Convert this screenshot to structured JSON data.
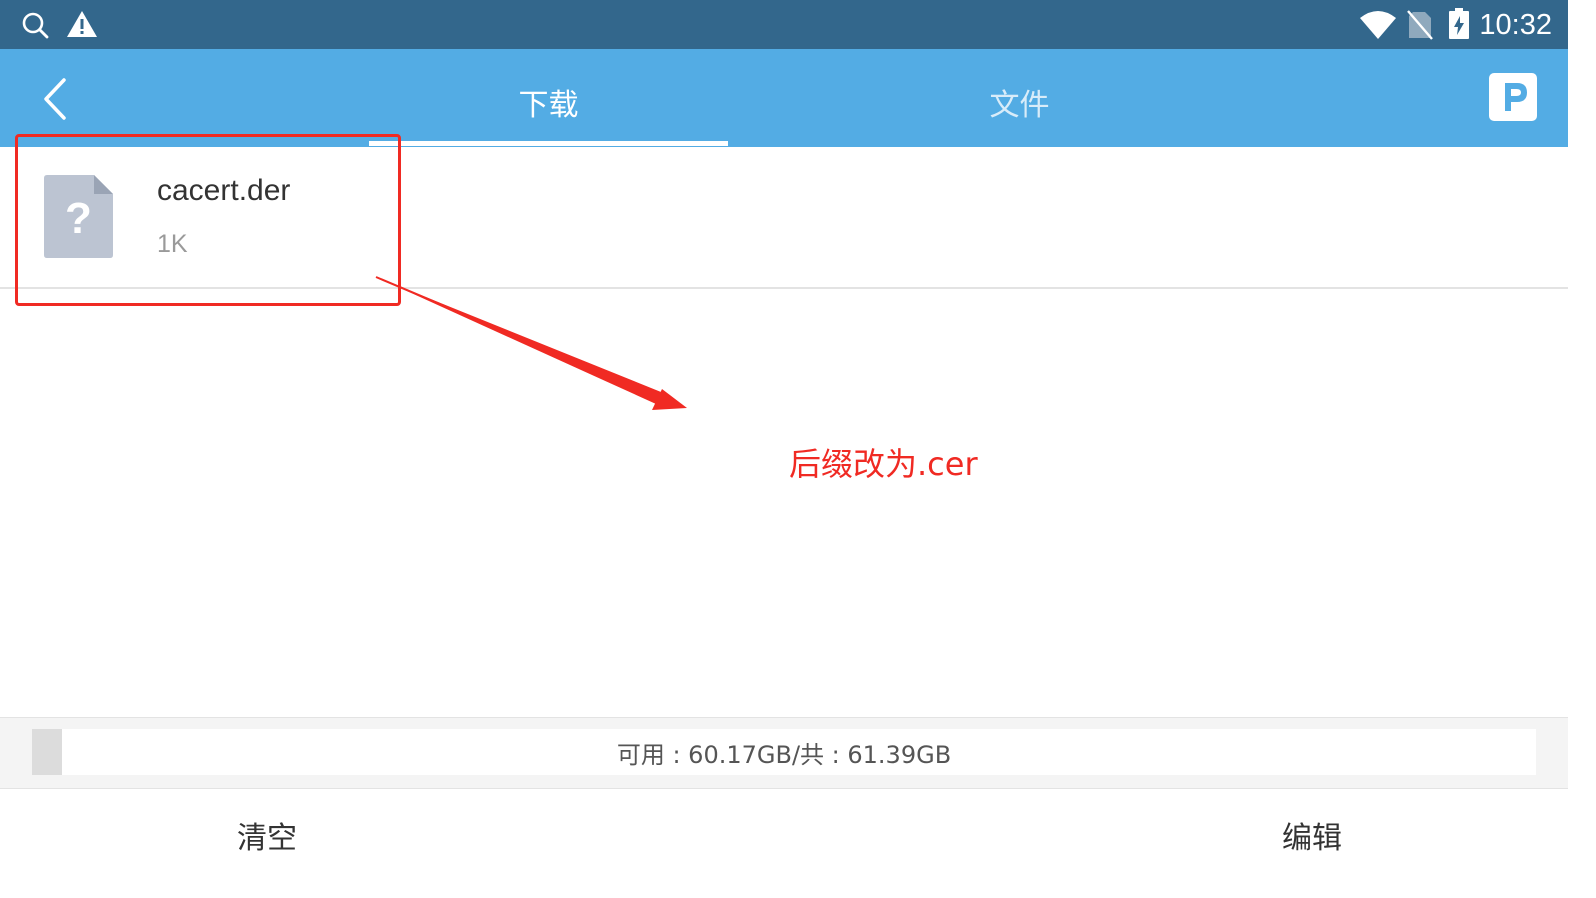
{
  "status_bar": {
    "time": "10:32",
    "icons": [
      "search-icon",
      "warning-icon",
      "wifi-icon",
      "no-sim-icon",
      "battery-charging-icon"
    ]
  },
  "header": {
    "back_icon": "back-chevron-icon",
    "tabs": [
      {
        "label": "下载",
        "active": true
      },
      {
        "label": "文件",
        "active": false
      }
    ],
    "logo_icon": "p-logo-icon"
  },
  "files": [
    {
      "name": "cacert.der",
      "size": "1K",
      "icon": "unknown-file-icon"
    }
  ],
  "annotation": {
    "text": "后缀改为.cer",
    "color": "#f02a23"
  },
  "storage": {
    "text": "可用 : 60.17GB/共 : 61.39GB",
    "used_fraction": 0.02
  },
  "actions": {
    "clear_label": "清空",
    "edit_label": "编辑"
  },
  "colors": {
    "status_bar": "#33678c",
    "app_bar": "#53ace4",
    "accent_red": "#f02a23"
  }
}
